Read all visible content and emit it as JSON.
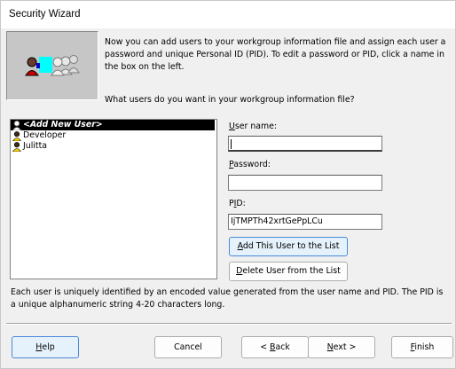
{
  "window": {
    "title": "Security Wizard"
  },
  "intro": {
    "text": "Now you can add users to your workgroup information file and assign each user a password and unique Personal ID (PID). To edit a password or PID, click a name in the box on the left.",
    "question": "What users do you want in your workgroup information file?"
  },
  "users": {
    "items": [
      {
        "label": "<Add New User>",
        "selected": true
      },
      {
        "label": "Developer",
        "selected": false
      },
      {
        "label": "Julitta",
        "selected": false
      }
    ]
  },
  "form": {
    "username_label_accel": "U",
    "username_label_rest": "ser name:",
    "username_value": "",
    "password_label_accel": "P",
    "password_label_rest": "assword:",
    "password_value": "",
    "pid_label_pre": "P",
    "pid_label_accel": "I",
    "pid_label_rest": "D:",
    "pid_value": "IjTMPTh42xrtGePpLCu",
    "add_button_accel": "A",
    "add_button_rest": "dd This User to the List",
    "delete_button_accel": "D",
    "delete_button_rest": "elete User from the List"
  },
  "info": {
    "text": "Each user is uniquely identified by an encoded value generated from the user name and PID. The PID is a unique alphanumeric string 4-20 characters long."
  },
  "footer": {
    "help_accel": "H",
    "help_rest": "elp",
    "cancel": "Cancel",
    "back_pre": "< ",
    "back_accel": "B",
    "back_rest": "ack",
    "next_accel": "N",
    "next_rest": "ext >",
    "finish_accel": "F",
    "finish_rest": "inish"
  }
}
